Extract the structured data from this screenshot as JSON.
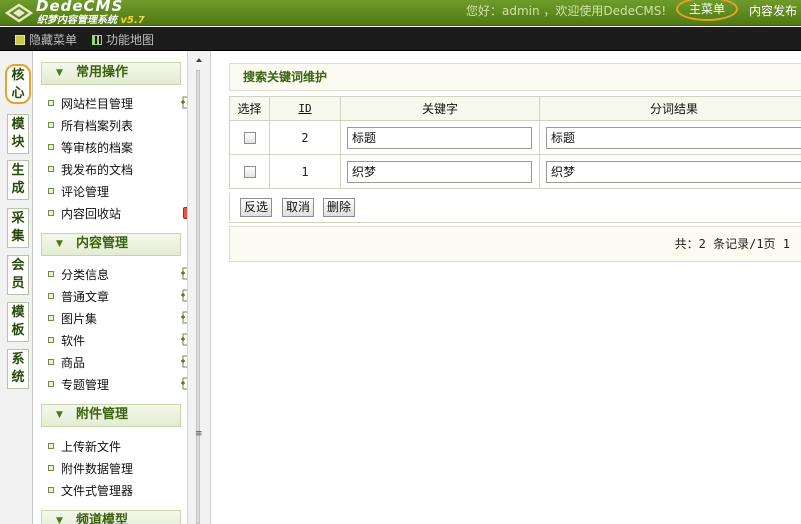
{
  "header": {
    "logo_text": "DedeCMS",
    "logo_sub": "织梦内容管理系统",
    "logo_version": "v5.7",
    "welcome": "您好：admin ，欢迎使用DedeCMS!",
    "main_menu": "主菜单",
    "content_publish": "内容发布"
  },
  "subbar": {
    "hide_menu": "隐藏菜单",
    "site_map": "功能地图"
  },
  "vtabs": [
    "核心",
    "模块",
    "生成",
    "采集",
    "会员",
    "模板",
    "系统"
  ],
  "menu": {
    "groups": [
      {
        "title": "常用操作",
        "items": [
          "网站栏目管理",
          "所有档案列表",
          "等审核的档案",
          "我发布的文档",
          "评论管理",
          "内容回收站"
        ]
      },
      {
        "title": "内容管理",
        "items": [
          "分类信息",
          "普通文章",
          "图片集",
          "软件",
          "商品",
          "专题管理"
        ]
      },
      {
        "title": "附件管理",
        "items": [
          "上传新文件",
          "附件数据管理",
          "文件式管理器"
        ]
      },
      {
        "title": "频道模型",
        "items": []
      }
    ]
  },
  "main": {
    "title": "搜索关键词维护",
    "columns": [
      "选择",
      "ID",
      "关键字",
      "分词结果"
    ],
    "rows": [
      {
        "id": "2",
        "keyword": "标题",
        "result": "标题"
      },
      {
        "id": "1",
        "keyword": "织梦",
        "result": "织梦"
      }
    ],
    "buttons": {
      "invert": "反选",
      "cancel": "取消",
      "delete": "删除"
    },
    "summary": "共：2 条记录/1页 1"
  },
  "colors": {
    "accent_green": "#4f7a14",
    "highlight_ring": "#e9a12a",
    "group_title": "#3a6410"
  }
}
